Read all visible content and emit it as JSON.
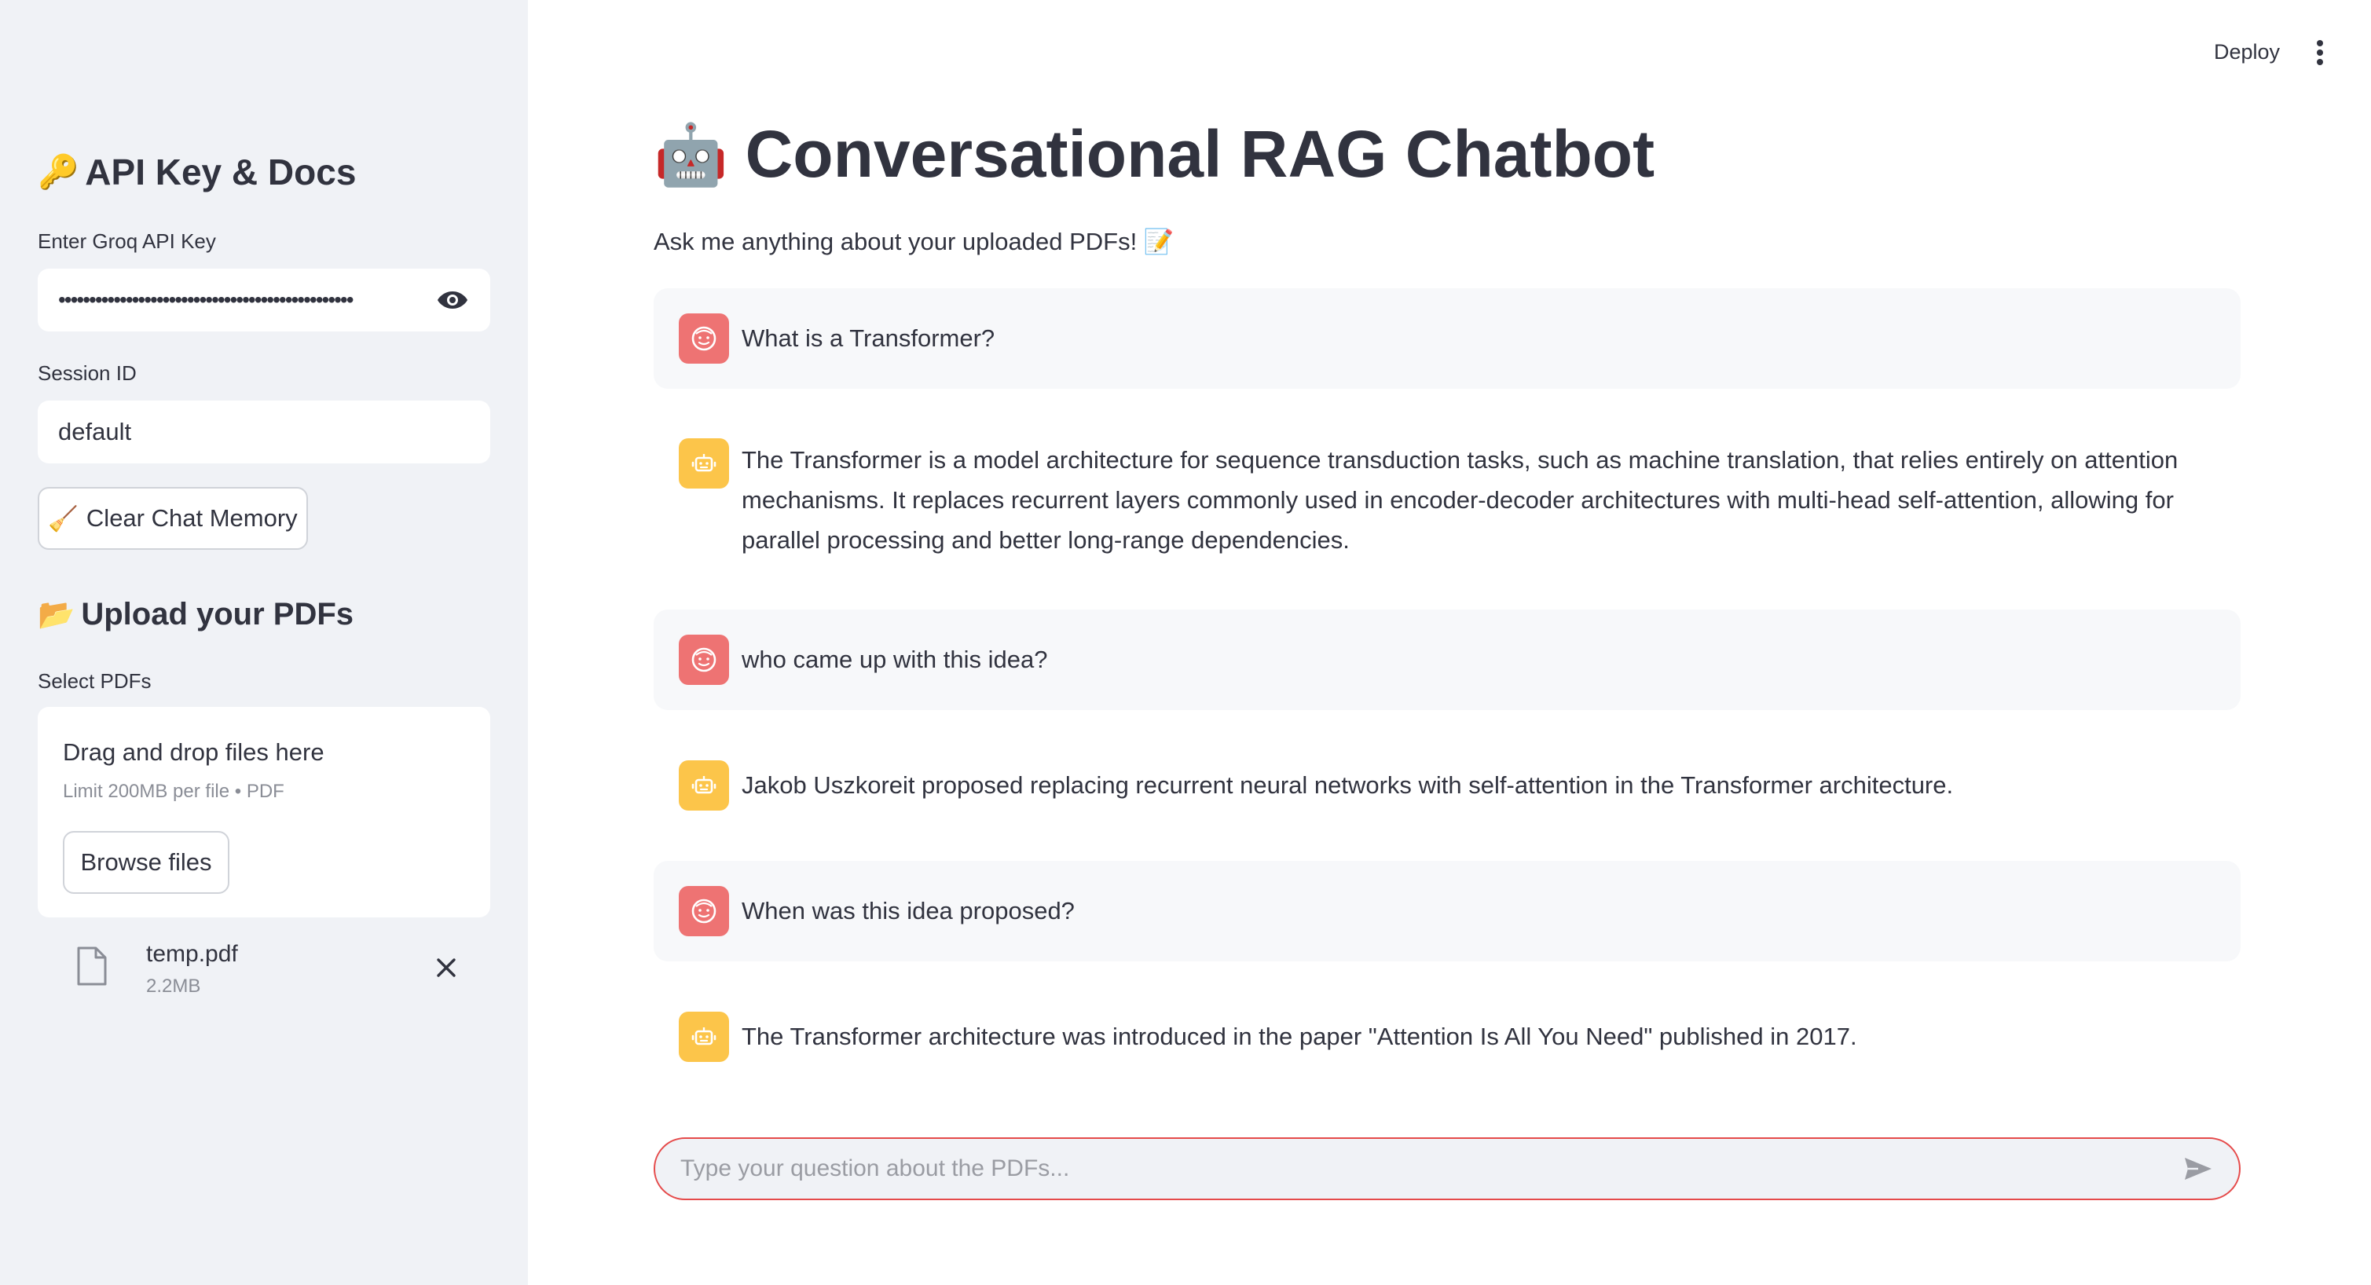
{
  "header": {
    "deploy_label": "Deploy",
    "menu_icon": "more-vertical-icon"
  },
  "sidebar": {
    "api_heading": "API Key & Docs",
    "api_heading_emoji": "🔑",
    "api_key_label": "Enter Groq API Key",
    "api_key_value": "••••••••••••••••••••••••••••••••••••••••••••••••",
    "session_label": "Session ID",
    "session_value": "default",
    "clear_button_emoji": "🧹",
    "clear_button_label": "Clear Chat Memory",
    "upload_heading": "Upload your PDFs",
    "upload_heading_emoji": "📂",
    "select_label": "Select PDFs",
    "drop_title": "Drag and drop files here",
    "drop_limit": "Limit 200MB per file • PDF",
    "browse_label": "Browse files",
    "file": {
      "name": "temp.pdf",
      "size": "2.2MB"
    }
  },
  "main": {
    "title_emoji": "🤖",
    "title": "Conversational RAG Chatbot",
    "subtitle": "Ask me anything about your uploaded PDFs! 📝",
    "messages": [
      {
        "role": "user",
        "text": "What is a Transformer?"
      },
      {
        "role": "assistant",
        "text": "The Transformer is a model architecture for sequence transduction tasks, such as machine translation, that relies entirely on attention mechanisms. It replaces recurrent layers commonly used in encoder-decoder architectures with multi-head self-attention, allowing for parallel processing and better long-range dependencies."
      },
      {
        "role": "user",
        "text": "who came up with this idea?"
      },
      {
        "role": "assistant",
        "text": "Jakob Uszkoreit proposed replacing recurrent neural networks with self-attention in the Transformer architecture."
      },
      {
        "role": "user",
        "text": "When was this idea proposed?"
      },
      {
        "role": "assistant",
        "text": "The Transformer architecture was introduced in the paper \"Attention Is All You Need\" published in 2017."
      }
    ],
    "chat_placeholder": "Type your question about the PDFs..."
  },
  "colors": {
    "sidebar_bg": "#f0f2f6",
    "user_avatar": "#ee7373",
    "bot_avatar": "#fcc54a",
    "input_border": "#e54a4a"
  }
}
